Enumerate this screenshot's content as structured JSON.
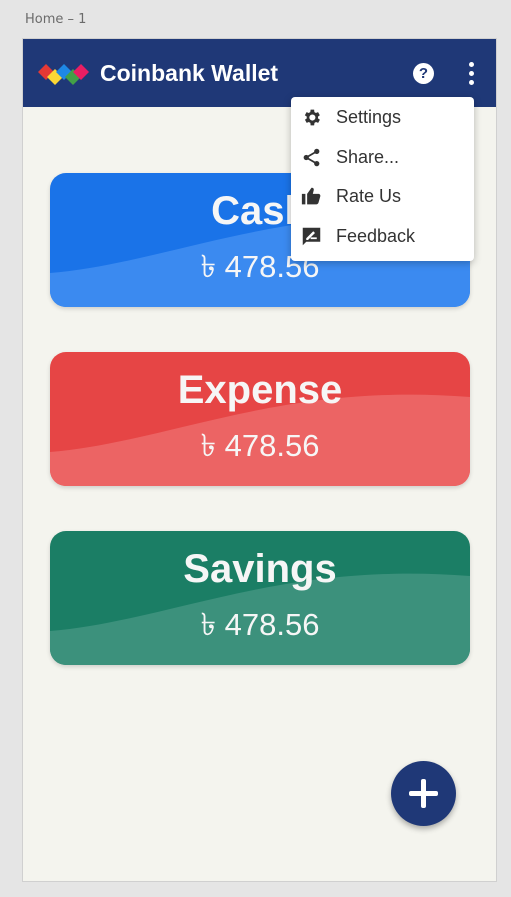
{
  "artboard": {
    "label": "Home – 1"
  },
  "appbar": {
    "title": "Coinbank Wallet",
    "help_icon": "help-circle-icon",
    "help_glyph": "?",
    "more_icon": "more-vertical-icon"
  },
  "cards": [
    {
      "title": "Cash",
      "amount": "৳ 478.56",
      "color_dark": "#1a73e8",
      "color_light": "#3b8af0"
    },
    {
      "title": "Expense",
      "amount": "৳ 478.56",
      "color_dark": "#e64545",
      "color_light": "#ec6464"
    },
    {
      "title": "Savings",
      "amount": "৳ 478.56",
      "color_dark": "#1b7e65",
      "color_light": "#3c917c"
    }
  ],
  "menu": {
    "items": [
      {
        "label": "Settings",
        "icon": "gear-icon"
      },
      {
        "label": "Share...",
        "icon": "share-icon"
      },
      {
        "label": "Rate Us",
        "icon": "thumbs-up-icon"
      },
      {
        "label": "Feedback",
        "icon": "feedback-icon"
      }
    ]
  },
  "fab": {
    "icon": "plus-icon"
  },
  "colors": {
    "appbar": "#1f3877",
    "background": "#f4f4ee",
    "fab": "#1f3877"
  }
}
